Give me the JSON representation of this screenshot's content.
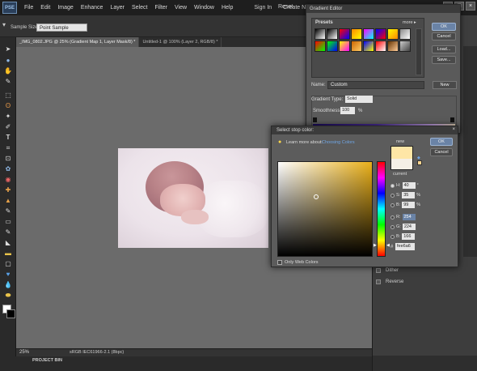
{
  "app": {
    "logo_text": "PSE",
    "menu": [
      "File",
      "Edit",
      "Image",
      "Enhance",
      "Layer",
      "Select",
      "Filter",
      "View",
      "Window",
      "Help"
    ],
    "sign_in": "Sign In",
    "create_id": "Create New Adobe ID",
    "reset_label": "Reset",
    "window_buttons": [
      "–",
      "□",
      "×"
    ]
  },
  "options_bar": {
    "sample_size_label": "Sample Size:",
    "sample_size_value": "Point Sample"
  },
  "tabs": [
    "_IMG_0802.JPG @ 25% (Gradient Map 1, Layer Mask/8) *",
    "Untitled-1 @ 100% (Layer 2, RGB/8) *"
  ],
  "status": {
    "zoom": "25%",
    "profile": "sRGB IEC61966-2.1 (8bpc)",
    "project_bin": "PROJECT BIN"
  },
  "right_panel": {
    "items": [
      "Dither",
      "Reverse"
    ]
  },
  "gradient_editor": {
    "title": "Gradient Editor",
    "presets_label": "Presets",
    "more_label": "more ▸",
    "buttons": {
      "ok": "OK",
      "cancel": "Cancel",
      "load": "Load...",
      "save": "Save..."
    },
    "name_label": "Name:",
    "name_value": "Custom",
    "new_button": "New",
    "gradient_type_label": "Gradient Type:",
    "gradient_type_value": "Solid",
    "smoothness_label": "Smoothness:",
    "smoothness_value": "100",
    "smoothness_unit": "%",
    "swatch_colors": [
      [
        "#000000",
        "#ffffff"
      ],
      [
        "#000000",
        "#ffffff"
      ],
      [
        "#ff0000",
        "#0000ff"
      ],
      [
        "#ff8800",
        "#ffff00"
      ],
      [
        "#ff00ff",
        "#00ffff"
      ],
      [
        "#0000ff",
        "#ff0000"
      ],
      [
        "#ffff00",
        "#ff8800"
      ],
      [
        "#888888",
        "#ffffff"
      ],
      [
        "#ff0000",
        "#00ff00"
      ],
      [
        "#00ff00",
        "#0000ff"
      ],
      [
        "#ffff00",
        "#ff00ff"
      ],
      [
        "#cc6600",
        "#ffcc66"
      ],
      [
        "#0000ff",
        "#ffff00"
      ],
      [
        "#ff0000",
        "#ffffff"
      ],
      [
        "#663300",
        "#ffcc99"
      ],
      [
        "#cccccc",
        "#444444"
      ]
    ]
  },
  "color_dialog": {
    "title": "Select stop color:",
    "close": "×",
    "learn_label": "Learn more about:",
    "learn_link": "Choosing Colors",
    "new_label": "new",
    "current_label": "current",
    "new_color": "#fee6a6",
    "buttons": {
      "ok": "OK",
      "cancel": "Cancel"
    },
    "fields": [
      {
        "label": "H:",
        "value": "40",
        "unit": "°"
      },
      {
        "label": "S:",
        "value": "35",
        "unit": "%"
      },
      {
        "label": "B:",
        "value": "99",
        "unit": "%"
      },
      {
        "label": "R:",
        "value": "254",
        "unit": ""
      },
      {
        "label": "G:",
        "value": "224",
        "unit": ""
      },
      {
        "label": "B:",
        "value": "166",
        "unit": ""
      }
    ],
    "hex_label": "#",
    "hex_value": "fee6a6",
    "only_web_colors": "Only Web Colors"
  }
}
